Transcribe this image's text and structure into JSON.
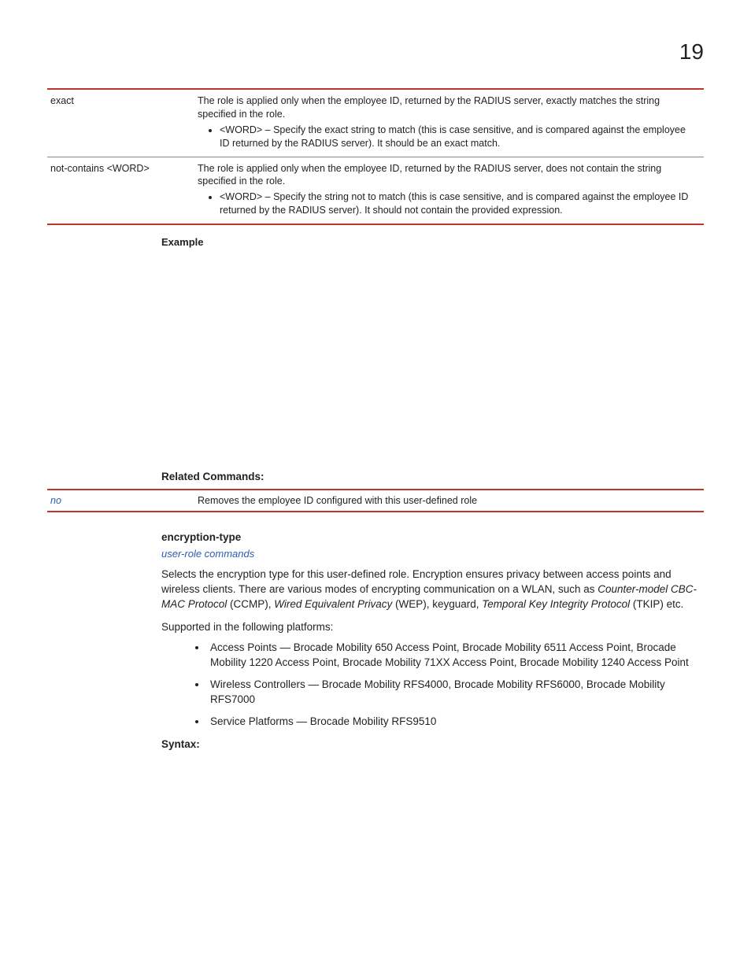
{
  "pageNumber": "19",
  "table1": {
    "rows": [
      {
        "key": "exact",
        "desc": "The role is applied only when the employee ID, returned by the RADIUS server, exactly matches the string specified in the role.",
        "bullet": "<WORD> – Specify the exact string to match (this is case sensitive, and is compared against the employee ID returned by the RADIUS server). It should be an exact match."
      },
      {
        "key": "not-contains <WORD>",
        "desc": "The role is applied only when the employee ID, returned by the RADIUS server, does not contain the string specified in the role.",
        "bullet": "<WORD> – Specify the string not to match (this is case sensitive, and is compared against the employee ID returned by the RADIUS server). It should not contain the provided expression."
      }
    ]
  },
  "exampleHeading": "Example",
  "relatedHeading": "Related Commands:",
  "relatedTable": {
    "key": "no",
    "desc": "Removes the employee ID configured with this user-defined role"
  },
  "section": {
    "heading": "encryption-type",
    "link": "user-role commands",
    "para1_pre": "Selects the encryption type for this user-defined role. Encryption ensures privacy between access points and wireless clients. There are various modes of encrypting communication on a WLAN, such as ",
    "para1_em1": "Counter-model CBC-MAC Protocol",
    "para1_mid1": " (CCMP), ",
    "para1_em2": "Wired Equivalent Privacy",
    "para1_mid2": " (WEP), keyguard, ",
    "para1_em3": "Temporal Key Integrity Protocol",
    "para1_post": " (TKIP) etc.",
    "para2": "Supported in the following platforms:",
    "bullets": [
      "Access Points — Brocade Mobility 650 Access Point, Brocade Mobility 6511 Access Point, Brocade Mobility 1220 Access Point, Brocade Mobility 71XX Access Point, Brocade Mobility 1240 Access Point",
      "Wireless Controllers — Brocade Mobility RFS4000, Brocade Mobility RFS6000, Brocade Mobility RFS7000",
      "Service Platforms — Brocade Mobility RFS9510"
    ],
    "syntax": "Syntax:"
  }
}
